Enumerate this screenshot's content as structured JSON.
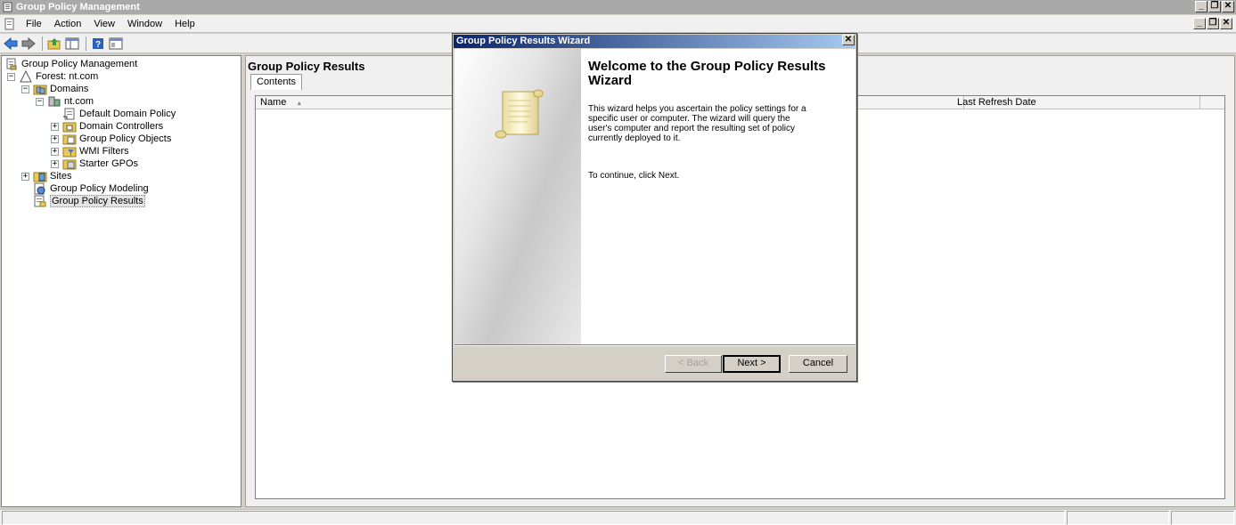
{
  "window": {
    "title": "Group Policy Management",
    "buttons": {
      "minimize": "_",
      "restore": "❐",
      "close": "✕"
    }
  },
  "menu": {
    "items": [
      {
        "label": "File"
      },
      {
        "label": "Action"
      },
      {
        "label": "View"
      },
      {
        "label": "Window"
      },
      {
        "label": "Help"
      }
    ]
  },
  "toolbar": {
    "buttons": [
      "back-arrow-icon",
      "forward-arrow-icon",
      "up-folder-icon",
      "show-hide-tree-icon",
      "help-icon",
      "properties-icon"
    ]
  },
  "tree": {
    "root": "Group Policy Management",
    "forest": "Forest: nt.com",
    "domains": "Domains",
    "domain": "nt.com",
    "default_domain_policy": "Default Domain Policy",
    "domain_controllers": "Domain Controllers",
    "gp_objects": "Group Policy Objects",
    "wmi_filters": "WMI Filters",
    "starter_gpos": "Starter GPOs",
    "sites": "Sites",
    "gp_modeling": "Group Policy Modeling",
    "gp_results": "Group Policy Results",
    "expand_plus": "+",
    "collapse_minus": "−"
  },
  "results_pane": {
    "title": "Group Policy Results",
    "tab": "Contents",
    "columns": [
      {
        "label": "Name",
        "sort_indicator": "▲"
      },
      {
        "label": "Last Refresh Date"
      }
    ]
  },
  "wizard": {
    "title": "Group Policy Results Wizard",
    "close": "✕",
    "heading": "Welcome to the Group Policy Results Wizard",
    "description": "This wizard helps you ascertain the policy settings for a specific user or computer. The wizard will query the user's computer and report the resulting set of policy currently deployed to it.",
    "continue_text": "To continue, click Next.",
    "back_label": "< Back",
    "next_label": "Next >",
    "cancel_label": "Cancel"
  },
  "colors": {
    "titlebar_inactive": "#a9a9a9",
    "dialog_title_start": "#0a246a",
    "dialog_title_end": "#a6caf0",
    "face": "#d4d0c8"
  }
}
